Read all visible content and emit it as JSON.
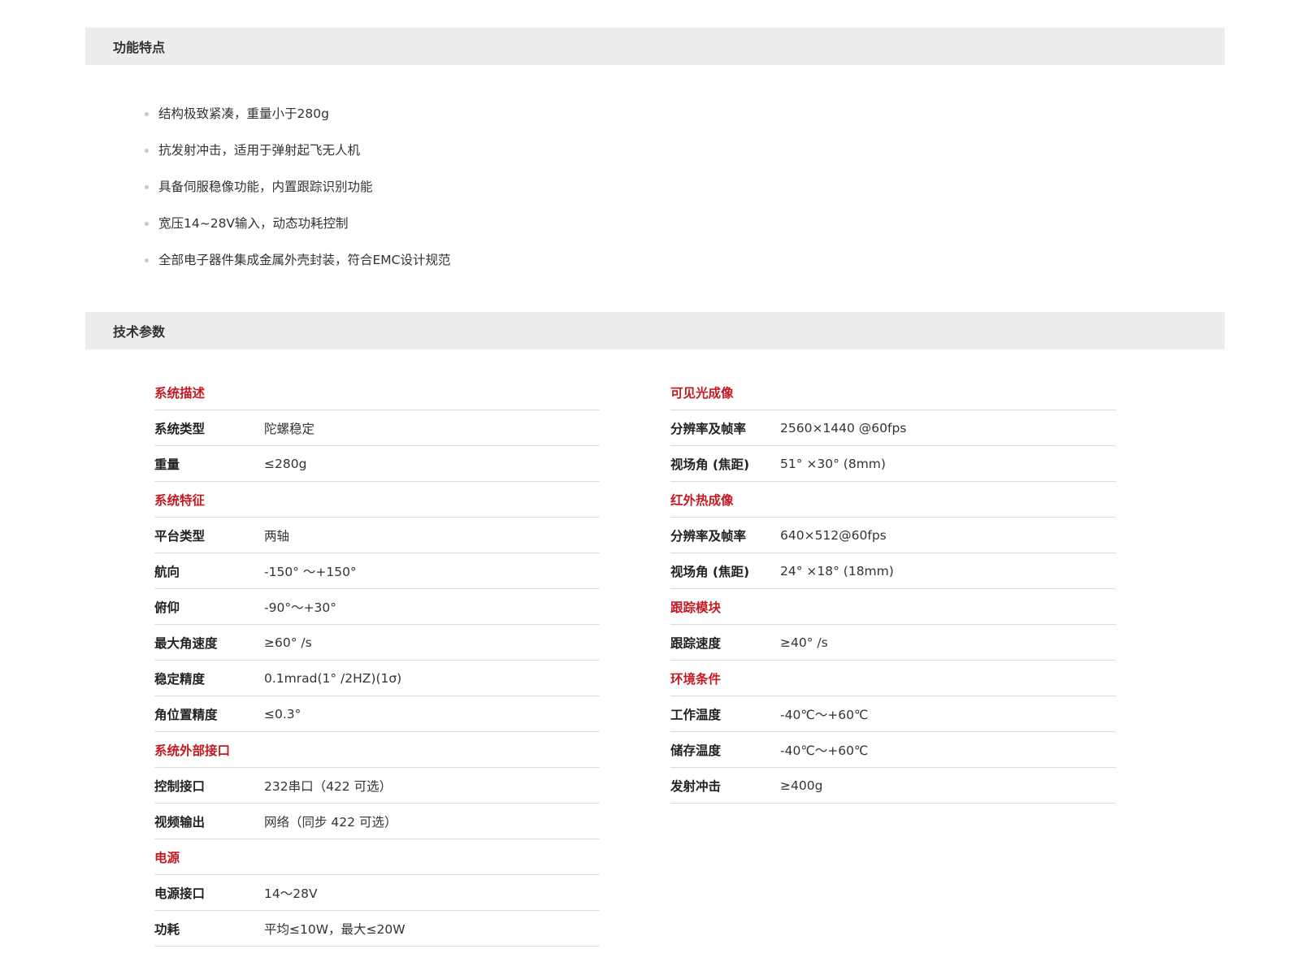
{
  "features_section": {
    "title": "功能特点",
    "items": [
      "结构极致紧凑，重量小于280g",
      "抗发射冲击，适用于弹射起飞无人机",
      "具备伺服稳像功能，内置跟踪识别功能",
      "宽压14~28V输入，动态功耗控制",
      "全部电子器件集成金属外壳封装，符合EMC设计规范"
    ]
  },
  "specs_section": {
    "title": "技术参数",
    "left_column": [
      {
        "group": "系统描述"
      },
      {
        "label": "系统类型",
        "value": "陀螺稳定"
      },
      {
        "label": "重量",
        "value": "≤280g"
      },
      {
        "group": "系统特征"
      },
      {
        "label": "平台类型",
        "value": "两轴"
      },
      {
        "label": "航向",
        "value": "-150° ～+150°"
      },
      {
        "label": "俯仰",
        "value": "-90°～+30°"
      },
      {
        "label": "最大角速度",
        "value": "≥60° /s"
      },
      {
        "label": "稳定精度",
        "value": "0.1mrad(1° /2HZ)(1σ)"
      },
      {
        "label": "角位置精度",
        "value": "≤0.3°"
      },
      {
        "group": "系统外部接口"
      },
      {
        "label": "控制接口",
        "value": "232串口（422 可选）"
      },
      {
        "label": "视频输出",
        "value": "网络（同步 422 可选）"
      },
      {
        "group": "电源"
      },
      {
        "label": "电源接口",
        "value": "14～28V"
      },
      {
        "label": "功耗",
        "value": "平均≤10W，最大≤20W"
      }
    ],
    "right_column": [
      {
        "group": "可见光成像"
      },
      {
        "label": "分辨率及帧率",
        "value": "2560×1440 @60fps"
      },
      {
        "label": "视场角 (焦距)",
        "value": "51° ×30° (8mm)"
      },
      {
        "group": "红外热成像"
      },
      {
        "label": "分辨率及帧率",
        "value": "640×512@60fps"
      },
      {
        "label": "视场角 (焦距)",
        "value": "24° ×18° (18mm)"
      },
      {
        "group": "跟踪模块"
      },
      {
        "label": "跟踪速度",
        "value": "≥40° /s"
      },
      {
        "group": "环境条件"
      },
      {
        "label": "工作温度",
        "value": "-40℃～+60℃"
      },
      {
        "label": "储存温度",
        "value": "-40℃～+60℃"
      },
      {
        "label": "发射冲击",
        "value": "≥400g"
      }
    ]
  },
  "colors": {
    "accent": "#c41a22",
    "header_bg": "#ededed",
    "divider": "#dcdcdc",
    "bullet": "#c8c8c8"
  }
}
